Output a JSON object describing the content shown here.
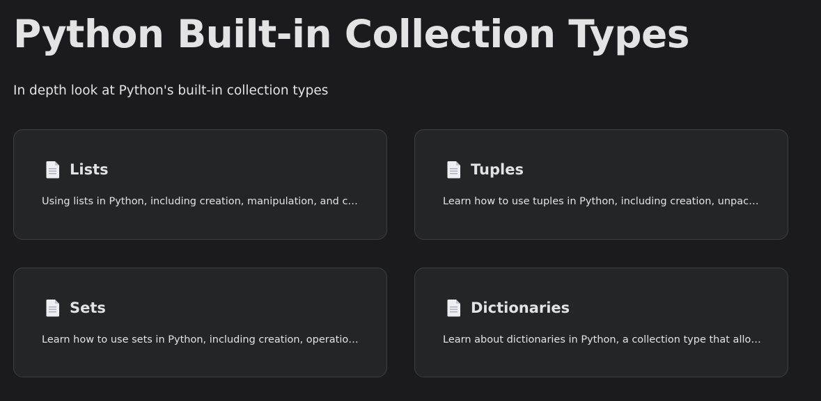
{
  "header": {
    "title": "Python Built-in Collection Types",
    "subtitle": "In depth look at Python's built-in collection types"
  },
  "cards": [
    {
      "icon": "document-icon",
      "title": "Lists",
      "description": "Using lists in Python, including creation, manipulation, and common operations"
    },
    {
      "icon": "document-icon",
      "title": "Tuples",
      "description": "Learn how to use tuples in Python, including creation, unpacking, and immutability"
    },
    {
      "icon": "document-icon",
      "title": "Sets",
      "description": "Learn how to use sets in Python, including creation, operations, and set methods"
    },
    {
      "icon": "document-icon",
      "title": "Dictionaries",
      "description": "Learn about dictionaries in Python, a collection type that allows key-value storage"
    }
  ],
  "colors": {
    "background": "#1b1b1d",
    "card_background": "#242526",
    "card_border": "#3e3f41",
    "text": "#e3e3e3"
  }
}
